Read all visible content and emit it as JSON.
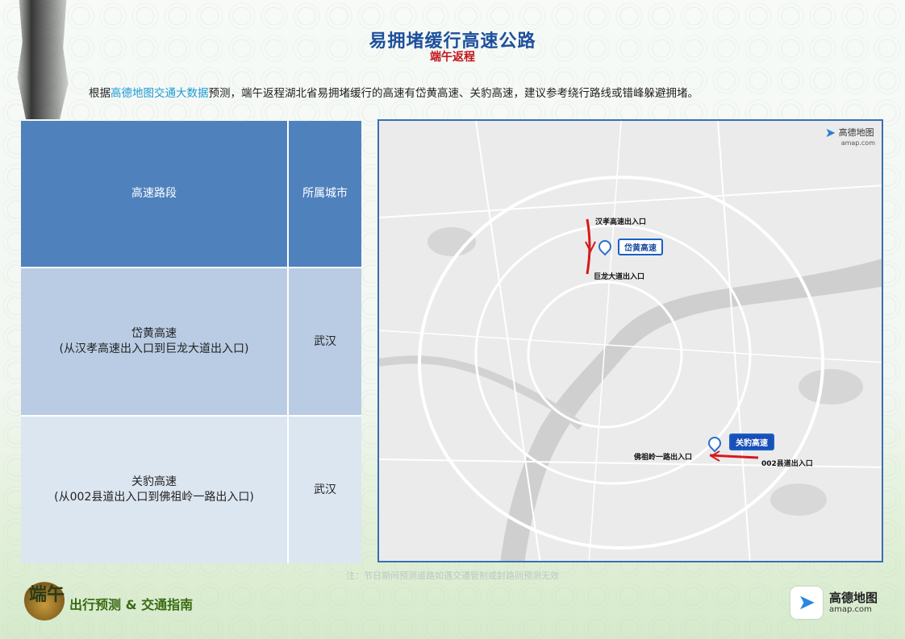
{
  "header": {
    "title": "易拥堵缓行高速公路",
    "subtitle": "端午返程"
  },
  "intro": {
    "prefix": "根据",
    "highlight": "高德地图交通大数据",
    "suffix": "预测，端午返程湖北省易拥堵缓行的高速有岱黄高速、关豹高速，建议参考绕行路线或错峰躲避拥堵。"
  },
  "table": {
    "headers": [
      "高速路段",
      "所属城市"
    ],
    "rows": [
      {
        "segment": "岱黄高速\n(从汉孝高速出入口到巨龙大道出入口)",
        "city": "武汉"
      },
      {
        "segment": "关豹高速\n(从002县道出入口到佛祖岭一路出入口)",
        "city": "武汉"
      }
    ]
  },
  "map": {
    "logo_name": "高德地图",
    "logo_url": "amap.com",
    "labels": {
      "hanxiao": "汉孝高速出入口",
      "julong": "巨龙大道出入口",
      "daihuang": "岱黄高速",
      "guanbao": "关豹高速",
      "fozuling": "佛祖岭一路出入口",
      "county002": "002县道出入口"
    },
    "colors": {
      "route": "#d7191c",
      "tag_border": "#1a5fc4"
    }
  },
  "note": "注：节日期间预测道路如遇交通管制或封路则预测无效",
  "footer": {
    "badge_text": "端午",
    "slogan": "出行预测 & 交通指南",
    "brand_name": "高德地图",
    "brand_url": "amap.com"
  }
}
